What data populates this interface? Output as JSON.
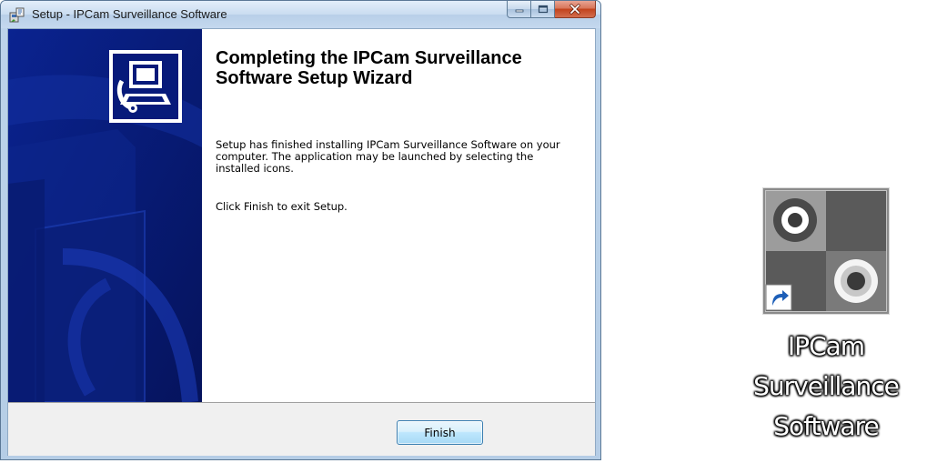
{
  "window": {
    "title": "Setup - IPCam Surveillance Software",
    "caption_buttons": [
      "minimize",
      "maximize",
      "close"
    ],
    "icons": {
      "app": "setup-installer-icon",
      "banner": "computer-install-icon"
    }
  },
  "wizard": {
    "heading": "Completing the IPCam Surveillance Software Setup Wizard",
    "paragraph1": "Setup has finished installing IPCam Surveillance Software on your computer. The application may be launched by selecting the installed icons.",
    "paragraph2": "Click Finish to exit Setup.",
    "finish_label": "Finish"
  },
  "desktop_shortcut": {
    "label_lines": [
      "IPCam",
      "Surveillance",
      "Software"
    ],
    "icon": "ipcam-app-icon",
    "overlay_icon": "shortcut-arrow-icon"
  },
  "colors": {
    "banner": "#071a7a",
    "close_button": "#c2421c",
    "button_face": "#f0f0f0"
  }
}
